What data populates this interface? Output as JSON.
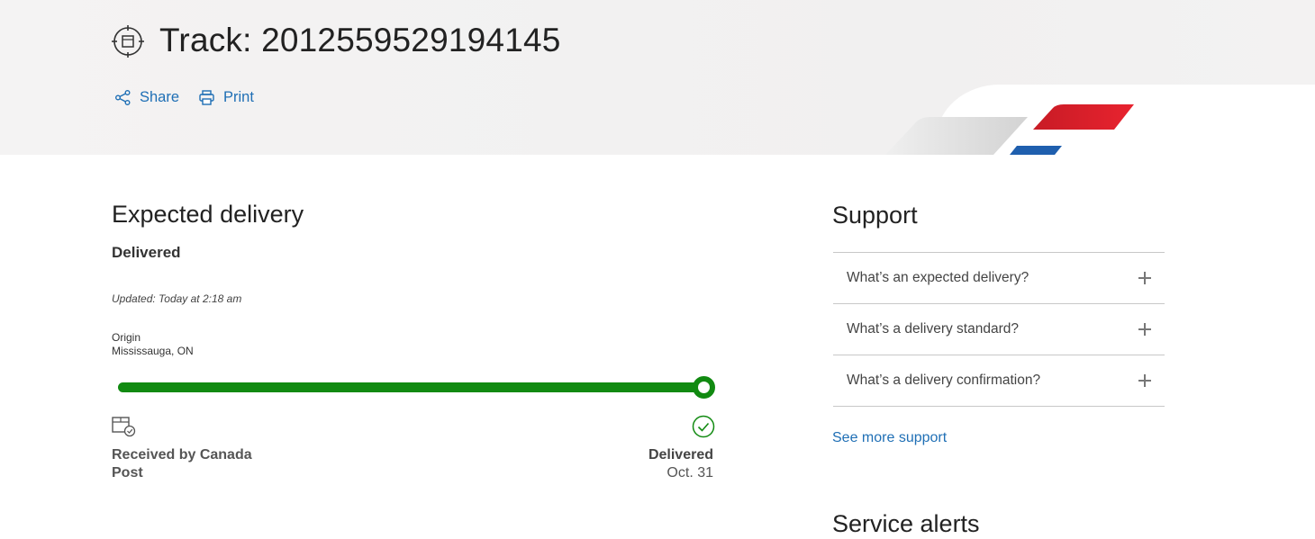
{
  "header": {
    "title": "Track: 2012559529194145",
    "share_label": "Share",
    "print_label": "Print",
    "link_color": "#1f6fb5"
  },
  "expected_delivery": {
    "heading": "Expected delivery",
    "status": "Delivered",
    "updated": "Updated: Today at 2:18 am",
    "origin_label": "Origin",
    "origin_value": "Mississauga, ON",
    "progress_fraction": 1.0,
    "progress_color": "#118a11",
    "start_step": {
      "icon": "package-received-icon",
      "label": "Received by Canada Post"
    },
    "end_step": {
      "icon": "check-circle-icon",
      "label": "Delivered",
      "date": "Oct. 31"
    }
  },
  "support": {
    "heading": "Support",
    "faqs": [
      {
        "label": "What’s an expected delivery?"
      },
      {
        "label": "What’s a delivery standard?"
      },
      {
        "label": "What’s a delivery confirmation?"
      }
    ],
    "see_more": "See more support"
  },
  "service_alerts": {
    "heading": "Service alerts"
  },
  "brand_colors": {
    "red": "#d71f2b",
    "blue": "#1f5fae",
    "grey": "#d9d9d9"
  }
}
